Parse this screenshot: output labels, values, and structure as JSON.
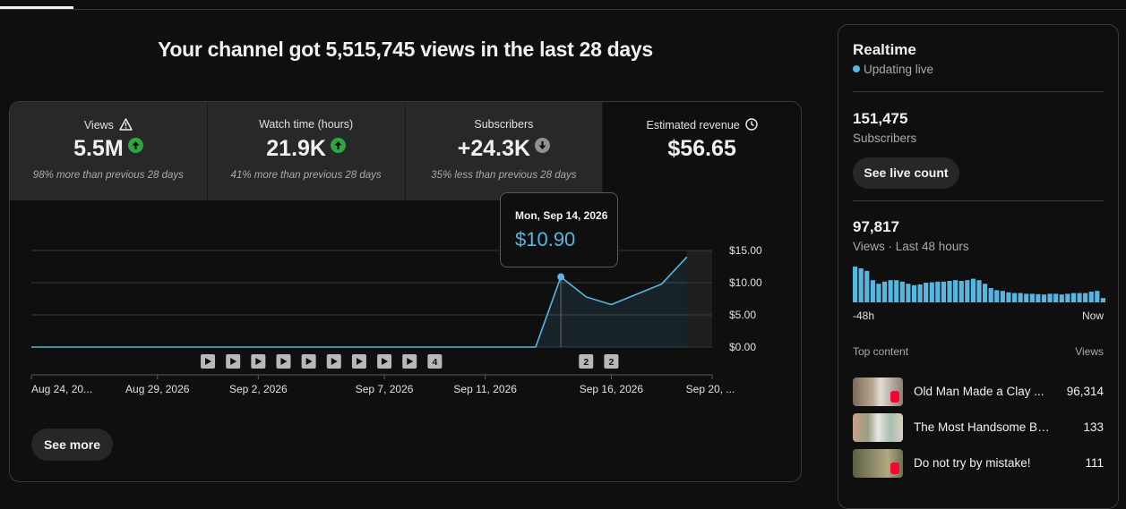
{
  "headline": "Your channel got 5,515,745 views in the last 28 days",
  "metrics": [
    {
      "label": "Views",
      "value": "5.5M",
      "trend": "up",
      "comparison": "98% more than previous 28 days",
      "extra_icon": "warning-icon"
    },
    {
      "label": "Watch time (hours)",
      "value": "21.9K",
      "trend": "up",
      "comparison": "41% more than previous 28 days"
    },
    {
      "label": "Subscribers",
      "value": "+24.3K",
      "trend": "down",
      "comparison": "35% less than previous 28 days"
    },
    {
      "label": "Estimated revenue",
      "value": "$56.65",
      "extra_icon": "clock-icon"
    }
  ],
  "tooltip": {
    "date": "Mon, Sep 14, 2026",
    "value": "$10.90"
  },
  "see_more_label": "See more",
  "chart_data": {
    "type": "area",
    "x": [
      "Aug 24",
      "Aug 25",
      "Aug 26",
      "Aug 27",
      "Aug 28",
      "Aug 29",
      "Aug 30",
      "Aug 31",
      "Sep 1",
      "Sep 2",
      "Sep 3",
      "Sep 4",
      "Sep 5",
      "Sep 6",
      "Sep 7",
      "Sep 8",
      "Sep 9",
      "Sep 10",
      "Sep 11",
      "Sep 12",
      "Sep 13",
      "Sep 14",
      "Sep 15",
      "Sep 16",
      "Sep 17",
      "Sep 18",
      "Sep 19",
      "Sep 20"
    ],
    "values": [
      0,
      0,
      0,
      0,
      0,
      0,
      0,
      0,
      0,
      0,
      0,
      0,
      0,
      0,
      0,
      0,
      0,
      0,
      0,
      0,
      0,
      10.9,
      7.8,
      6.6,
      8.2,
      9.8,
      14.0,
      null
    ],
    "x_tick_labels": [
      "Aug 24, 20...",
      "Aug 29, 2026",
      "Sep 2, 2026",
      "Sep 7, 2026",
      "Sep 11, 2026",
      "Sep 16, 2026",
      "Sep 20, ..."
    ],
    "x_tick_dates": [
      "Aug 24",
      "Aug 29",
      "Sep 2",
      "Sep 7",
      "Sep 11",
      "Sep 16",
      "Sep 20"
    ],
    "y_ticks": [
      "$15.00",
      "$10.00",
      "$5.00",
      "$0.00"
    ],
    "y_tick_values": [
      15,
      10,
      5,
      0
    ],
    "ylim": [
      0,
      15
    ],
    "highlight_date": "Sep 14",
    "line_color": "#56b6e0",
    "video_markers": [
      {
        "date": "Aug 31",
        "label": ""
      },
      {
        "date": "Sep 1",
        "label": ""
      },
      {
        "date": "Sep 2",
        "label": ""
      },
      {
        "date": "Sep 3",
        "label": ""
      },
      {
        "date": "Sep 4",
        "label": ""
      },
      {
        "date": "Sep 5",
        "label": ""
      },
      {
        "date": "Sep 6",
        "label": ""
      },
      {
        "date": "Sep 7",
        "label": ""
      },
      {
        "date": "Sep 8",
        "label": ""
      },
      {
        "date": "Sep 9",
        "label": "4"
      },
      {
        "date": "Sep 15",
        "label": "2"
      },
      {
        "date": "Sep 16",
        "label": "2"
      }
    ]
  },
  "realtime": {
    "title": "Realtime",
    "status": "Updating live",
    "subscribers_value": "151,475",
    "subscribers_label": "Subscribers",
    "live_count_button": "See live count",
    "views_value": "97,817",
    "views_label": "Views · Last 48 hours",
    "axis_left": "-48h",
    "axis_right": "Now",
    "bars": [
      1.0,
      0.95,
      0.88,
      0.62,
      0.52,
      0.58,
      0.62,
      0.62,
      0.58,
      0.52,
      0.48,
      0.5,
      0.55,
      0.56,
      0.58,
      0.58,
      0.6,
      0.62,
      0.6,
      0.62,
      0.66,
      0.62,
      0.52,
      0.4,
      0.34,
      0.32,
      0.28,
      0.26,
      0.26,
      0.24,
      0.24,
      0.23,
      0.22,
      0.24,
      0.24,
      0.22,
      0.24,
      0.26,
      0.26,
      0.26,
      0.3,
      0.32,
      0.12
    ],
    "bar_color": "#56b6e0",
    "top_content_label": "Top content",
    "views_column_label": "Views",
    "top_content": [
      {
        "title": "Old Man Made a Clay ...",
        "views": "96,314"
      },
      {
        "title": "The Most Handsome Bo...",
        "views": "133"
      },
      {
        "title": "Do not try by mistake!",
        "views": "111"
      }
    ]
  }
}
